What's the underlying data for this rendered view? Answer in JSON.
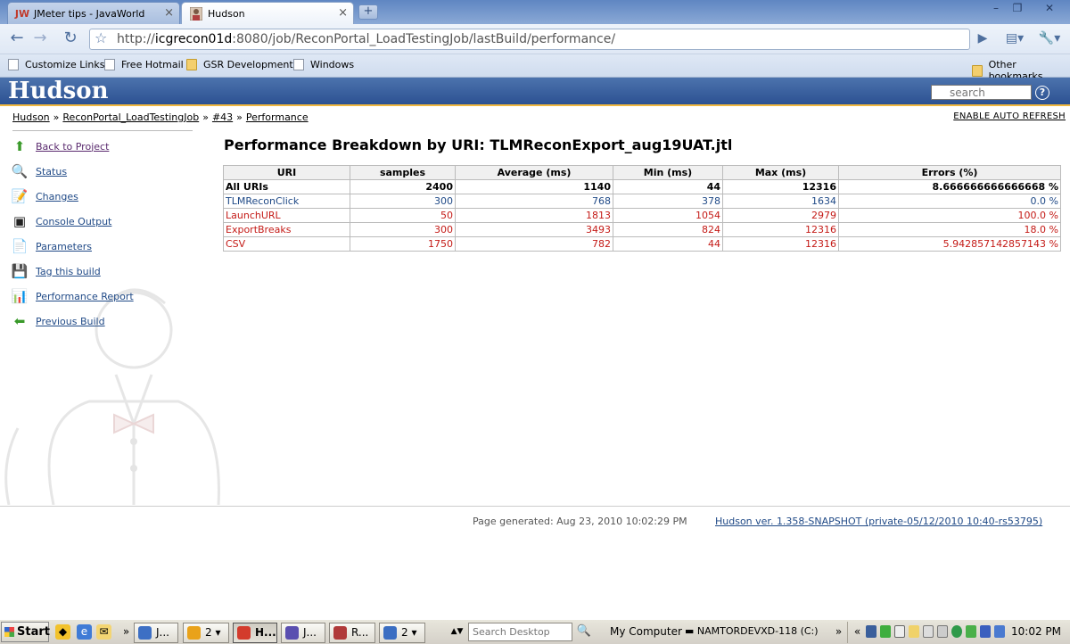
{
  "browser": {
    "tabs": [
      {
        "title": "JMeter tips - JavaWorld",
        "favicon": "JW"
      },
      {
        "title": "Hudson",
        "favicon": "hudson-avatar"
      }
    ],
    "url": {
      "scheme": "http://",
      "host": "icgrecon01d",
      "rest": ":8080/job/ReconPortal_LoadTestingJob/lastBuild/performance/"
    },
    "bookmarks": [
      {
        "label": "Customize Links",
        "icon": "page"
      },
      {
        "label": "Free Hotmail",
        "icon": "page"
      },
      {
        "label": "GSR Development",
        "icon": "folder"
      },
      {
        "label": "Windows",
        "icon": "page"
      }
    ],
    "other_bookmarks": "Other bookmarks"
  },
  "hudson": {
    "logo": "Hudson",
    "search_placeholder": "search",
    "help": "?",
    "breadcrumb": [
      "Hudson",
      "ReconPortal_LoadTestingJob",
      "#43",
      "Performance"
    ],
    "breadcrumb_sep": "»",
    "auto_refresh": "ENABLE AUTO REFRESH"
  },
  "sidebar": {
    "tasks": [
      {
        "label": "Back to Project",
        "icon": "up-arrow-icon",
        "glyph": "⬆",
        "color": "#3a9a2a"
      },
      {
        "label": "Status",
        "icon": "magnifier-icon",
        "glyph": "🔍",
        "color": "#3b6aa8"
      },
      {
        "label": "Changes",
        "icon": "notepad-icon",
        "glyph": "📝",
        "color": "#8a6a2a"
      },
      {
        "label": "Console Output",
        "icon": "terminal-icon",
        "glyph": "▣",
        "color": "#222222"
      },
      {
        "label": "Parameters",
        "icon": "document-gear-icon",
        "glyph": "📄",
        "color": "#888888"
      },
      {
        "label": "Tag this build",
        "icon": "floppy-disk-icon",
        "glyph": "💾",
        "color": "#3b5fa0"
      },
      {
        "label": "Performance Report",
        "icon": "report-icon",
        "glyph": "📊",
        "color": "#a03030"
      },
      {
        "label": "Previous Build",
        "icon": "left-arrow-icon",
        "glyph": "⬅",
        "color": "#3a9a2a"
      }
    ]
  },
  "main": {
    "title": "Performance Breakdown by URI: TLMReconExport_aug19UAT.jtl",
    "table": {
      "headers": [
        "URI",
        "samples",
        "Average (ms)",
        "Min (ms)",
        "Max (ms)",
        "Errors (%)"
      ],
      "rows": [
        {
          "uri": "All URIs",
          "samples": "2400",
          "average": "1140",
          "min": "44",
          "max": "12316",
          "errors": "8.666666666666668 %",
          "status": "all"
        },
        {
          "uri": "TLMReconClick",
          "samples": "300",
          "average": "768",
          "min": "378",
          "max": "1634",
          "errors": "0.0 %",
          "status": "ok"
        },
        {
          "uri": "LaunchURL",
          "samples": "50",
          "average": "1813",
          "min": "1054",
          "max": "2979",
          "errors": "100.0 %",
          "status": "fail"
        },
        {
          "uri": "ExportBreaks",
          "samples": "300",
          "average": "3493",
          "min": "824",
          "max": "12316",
          "errors": "18.0 %",
          "status": "fail"
        },
        {
          "uri": "CSV",
          "samples": "1750",
          "average": "782",
          "min": "44",
          "max": "12316",
          "errors": "5.942857142857143 %",
          "status": "fail"
        }
      ]
    }
  },
  "footer": {
    "generated": "Page generated: Aug 23, 2010 10:02:29 PM",
    "version": "Hudson ver. 1.358-SNAPSHOT (private-05/12/2010 10:40-rs53795)"
  },
  "taskbar": {
    "start": "Start",
    "buttons": [
      {
        "label": "J...",
        "color": "#3d6fc4"
      },
      {
        "label": "2 ▾",
        "color": "#e9a21a"
      },
      {
        "label": "H...",
        "color": "#d33b2c",
        "pressed": true
      },
      {
        "label": "J...",
        "color": "#5a4fb0"
      },
      {
        "label": "R...",
        "color": "#b03a3a"
      },
      {
        "label": "2 ▾",
        "color": "#3b6ec2"
      }
    ],
    "search_placeholder": "Search Desktop",
    "my_computer": "My Computer",
    "drive": "NAMTORDEVXD-118 (C:)",
    "clock": "10:02 PM"
  },
  "colors": {
    "hudson_bar": "#2c5192",
    "accent_rule": "#f0b840",
    "ok_text": "#204a87",
    "fail_text": "#c41a16"
  }
}
